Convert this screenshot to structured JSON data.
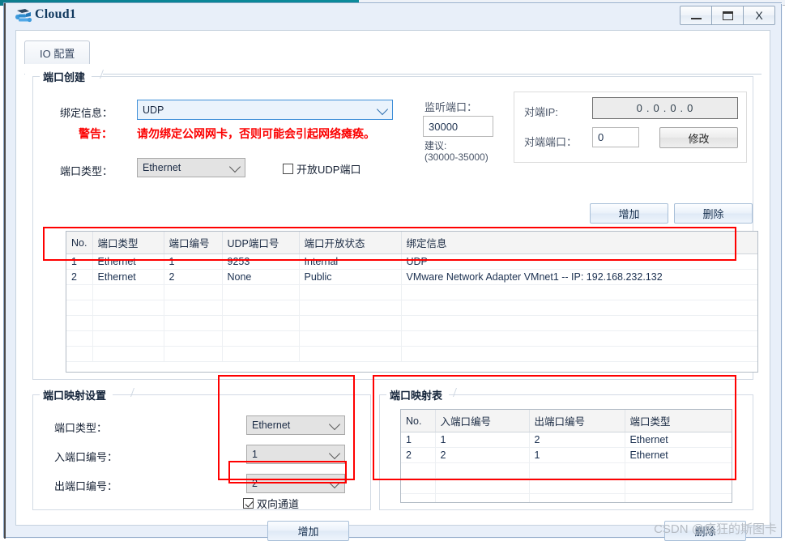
{
  "window": {
    "title": "Cloud1",
    "icon": "cloud-icon",
    "minimize_label": "–",
    "maximize_label": "□",
    "close_label": "X"
  },
  "tabs": [
    {
      "label": "IO 配置",
      "active": true
    }
  ],
  "port_create": {
    "group_title": "端口创建",
    "bind_info_label": "绑定信息：",
    "bind_info_value": "UDP",
    "warning_label": "警告：",
    "warning_text": "请勿绑定公网网卡，否则可能会引起网络瘫痪。",
    "port_type_label": "端口类型：",
    "port_type_value": "Ethernet",
    "open_udp_checkbox_label": "开放UDP端口",
    "open_udp_checked": false,
    "listen_port_label": "监听端口：",
    "listen_port_value": "30000",
    "suggest_line1": "建议:",
    "suggest_line2": "(30000-35000)",
    "peer_ip_label": "对端IP:",
    "peer_ip_octets": [
      "0",
      "0",
      "0",
      "0"
    ],
    "peer_ip_separator": ".",
    "peer_port_label": "对端端口：",
    "peer_port_value": "0",
    "modify_button": "修改",
    "add_button": "增加",
    "delete_button": "删除"
  },
  "port_table": {
    "columns": [
      "No.",
      "端口类型",
      "端口编号",
      "UDP端口号",
      "端口开放状态",
      "绑定信息"
    ],
    "rows": [
      [
        "1",
        "Ethernet",
        "1",
        "9253",
        "Internal",
        "UDP"
      ],
      [
        "2",
        "Ethernet",
        "2",
        "None",
        "Public",
        "VMware Network Adapter VMnet1 -- IP: 192.168.232.132"
      ]
    ],
    "empty_rows": 5
  },
  "mapping_settings": {
    "group_title": "端口映射设置",
    "port_type_label": "端口类型：",
    "port_type_value": "Ethernet",
    "in_port_label": "入端口编号：",
    "in_port_value": "1",
    "out_port_label": "出端口编号：",
    "out_port_value": "2",
    "bidirectional_label": "双向通道",
    "bidirectional_checked": true,
    "add_button": "增加"
  },
  "mapping_table": {
    "group_title": "端口映射表",
    "columns": [
      "No.",
      "入端口编号",
      "出端口编号",
      "端口类型"
    ],
    "rows": [
      [
        "1",
        "1",
        "2",
        "Ethernet"
      ],
      [
        "2",
        "2",
        "1",
        "Ethernet"
      ]
    ],
    "empty_rows": 4,
    "delete_button": "删除"
  },
  "watermark": "CSDN @疯狂的斯图卡",
  "colors": {
    "accent_blue": "#3f8fd8",
    "warning_red": "#fb0000",
    "annotation_red": "#ff0000",
    "title_blue": "#10385e",
    "teal_strip": "#0a8496"
  }
}
